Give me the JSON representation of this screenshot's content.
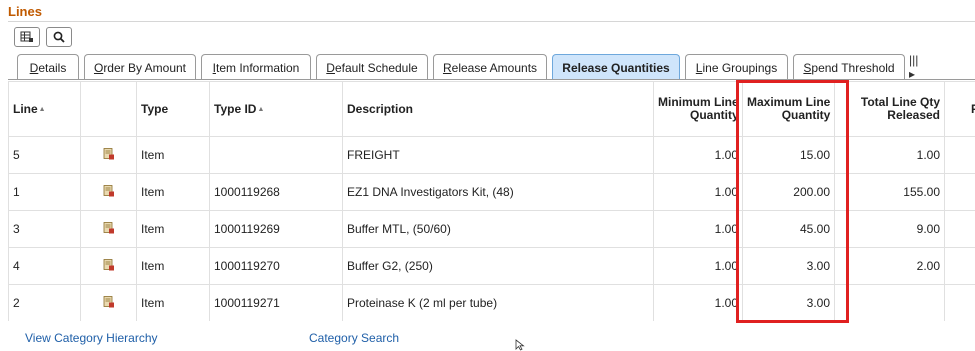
{
  "section": {
    "title": "Lines"
  },
  "toolbar": [
    {
      "name": "personalize-grid-button",
      "icon": "grid-settings-icon"
    },
    {
      "name": "find-button",
      "icon": "search-icon"
    }
  ],
  "tabs": [
    {
      "underline": "D",
      "rest": "etails",
      "active": false
    },
    {
      "underline": "O",
      "rest": "rder By Amount",
      "active": false
    },
    {
      "underline": "I",
      "rest": "tem Information",
      "active": false
    },
    {
      "underline": "D",
      "rest": "efault Schedule",
      "active": false
    },
    {
      "underline": "R",
      "rest": "elease Amounts",
      "active": false
    },
    {
      "underline": "",
      "rest": "Release Quantities",
      "active": true
    },
    {
      "underline": "L",
      "rest": "ine Groupings",
      "active": false
    },
    {
      "underline": "S",
      "rest": "pend Threshold",
      "active": false
    }
  ],
  "tab_more": "|||▸",
  "columns": {
    "line": "Line",
    "type": "Type",
    "type_id": "Type ID",
    "description": "Description",
    "min_qty": [
      "Minimum Line",
      "Quantity"
    ],
    "max_qty": [
      "Maximum Line",
      "Quantity"
    ],
    "released": [
      "Total Line Qty",
      "Released"
    ],
    "next": "F"
  },
  "rows": [
    {
      "line": "5",
      "type": "Item",
      "type_id": "",
      "description": "FREIGHT",
      "min_qty": "1.00",
      "max_qty": "15.00",
      "released": "1.00"
    },
    {
      "line": "1",
      "type": "Item",
      "type_id": "1000119268",
      "description": "EZ1 DNA Investigators Kit, (48)",
      "min_qty": "1.00",
      "max_qty": "200.00",
      "released": "155.00"
    },
    {
      "line": "3",
      "type": "Item",
      "type_id": "1000119269",
      "description": "Buffer MTL, (50/60)",
      "min_qty": "1.00",
      "max_qty": "45.00",
      "released": "9.00"
    },
    {
      "line": "4",
      "type": "Item",
      "type_id": "1000119270",
      "description": "Buffer G2, (250)",
      "min_qty": "1.00",
      "max_qty": "3.00",
      "released": "2.00"
    },
    {
      "line": "2",
      "type": "Item",
      "type_id": "1000119271",
      "description": "Proteinase K (2 ml per tube)",
      "min_qty": "1.00",
      "max_qty": "3.00",
      "released": ""
    }
  ],
  "links": {
    "category_hierarchy": "View Category Hierarchy",
    "category_search": "Category Search"
  },
  "colors": {
    "title": "#c05a00",
    "active_tab": "#cfe5fb",
    "highlight": "#e02020",
    "link": "#1f5fa8"
  }
}
